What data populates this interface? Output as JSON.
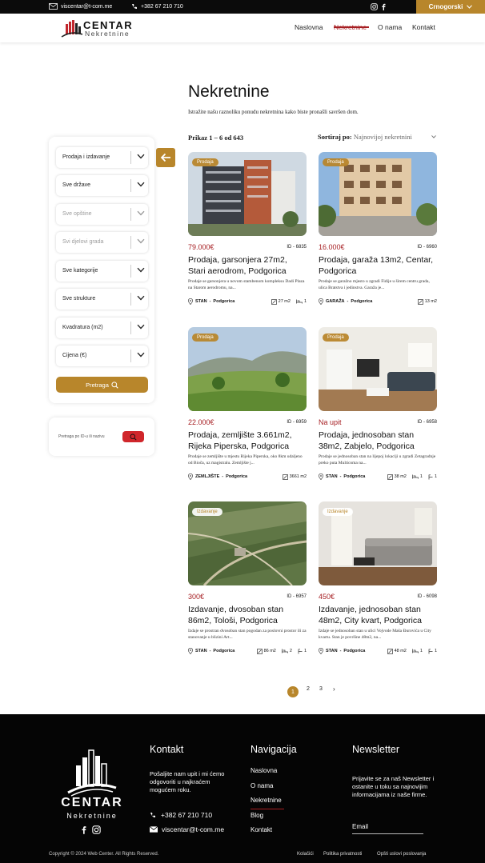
{
  "topbar": {
    "email": "viscentar@t-com.me",
    "phone": "+382 67 210 710",
    "language": "Crnogorski"
  },
  "header": {
    "logo_main": "CENTAR",
    "logo_sub": "Nekretnine",
    "nav": [
      "Naslovna",
      "Nekretnine",
      "O nama",
      "Kontakt"
    ],
    "active_nav": "Nekretnine"
  },
  "page": {
    "title": "Nekretnine",
    "intro": "Istražite našu raznoliku ponudu nekretnina kako biste pronašli savršen dom.",
    "count_text": "Prikaz 1 – 6 od 643",
    "sort_label": "Sortiraj po:",
    "sort_value": "Najnovijoj nekretnini"
  },
  "filters": {
    "selects": [
      {
        "value": "Prodaja i izdavanje",
        "disabled": false
      },
      {
        "value": "Sve države",
        "disabled": false
      },
      {
        "value": "Sve opštine",
        "disabled": true
      },
      {
        "value": "Svi djelovi grada",
        "disabled": true
      },
      {
        "value": "Sve kategorije",
        "disabled": false
      },
      {
        "value": "Sve strukture",
        "disabled": false
      },
      {
        "value": "Kvadratura (m2)",
        "disabled": false
      },
      {
        "value": "Cijena (€)",
        "disabled": false
      }
    ],
    "search_button": "Pretraga",
    "id_search_placeholder": "Pretraga po ID-u ili nazivu"
  },
  "listings": [
    {
      "badge": "Prodaja",
      "price": "79.000€",
      "id": "ID - 6835",
      "title": "Prodaja, garsonjera 27m2, Stari aerodrom, Podgorica",
      "desc": "Prodaje se garsonjera u novom stambenom kompleksu Dadi Plaza na Starom aerodromu, na...",
      "type": "STAN",
      "city": "Podgorica",
      "area": "27 m2",
      "rooms": "1",
      "baths": "",
      "image": "apartment-building-construction"
    },
    {
      "badge": "Prodaja",
      "price": "16.000€",
      "id": "ID - 6960",
      "title": "Prodaja, garaža 13m2, Centar, Podgorica",
      "desc": "Prodaje se garažno mjesto u zgradi Fidije u širem centru grada, ulica Bratstva i jedinstva. Garaža je...",
      "type": "GARAŽA",
      "city": "Podgorica",
      "area": "13 m2",
      "rooms": "",
      "baths": "",
      "image": "residential-building"
    },
    {
      "badge": "Prodaja",
      "price": "22.000€",
      "id": "ID - 6959",
      "title": "Prodaja, zemljište 3.661m2, Rijeka Piperska, Podgorica",
      "desc": "Prodaje se zemljište u mjestu Rijeka Piperska, oko 8km udaljeno od Bioča, uz magistralu. Zemljište j...",
      "type": "ZEMLJIŠTE",
      "city": "Podgorica",
      "area": "3661 m2",
      "rooms": "",
      "baths": "",
      "image": "land-with-hills"
    },
    {
      "badge": "Prodaja",
      "price": "Na upit",
      "id": "ID - 6958",
      "title": "Prodaja, jednosoban stan 38m2, Zabjelo, Podgorica",
      "desc": "Prodaje se jednosoban stan na lijepoj lokaciji u zgradi Zetagradnje preko puta Multicoma na...",
      "type": "STAN",
      "city": "Podgorica",
      "area": "38 m2",
      "rooms": "1",
      "baths": "1",
      "image": "living-room-interior"
    },
    {
      "badge": "Izdavanje",
      "price": "300€",
      "id": "ID - 6957",
      "title": "Izdavanje, dvosoban stan 86m2, Tološi, Podgorica",
      "desc": "Izdaje se prostran dvosoban stan pogodan za poslovni prostor ili za stanovanje u blizini Art...",
      "type": "STAN",
      "city": "Podgorica",
      "area": "86 m2",
      "rooms": "2",
      "baths": "1",
      "image": "aerial-map"
    },
    {
      "badge": "Izdavanje",
      "price": "450€",
      "id": "ID - 6098",
      "title": "Izdavanje, jednosoban stan 48m2, City kvart, Podgorica",
      "desc": "Izdaje se jednosoban stan u ulici Vojvode Maša Đurovića u City kvartu. Stan je površine 48m2, na...",
      "type": "STAN",
      "city": "Podgorica",
      "area": "48 m2",
      "rooms": "1",
      "baths": "1",
      "image": "living-room-sofa"
    }
  ],
  "pagination": {
    "pages": [
      "1",
      "2",
      "3"
    ],
    "current": "1",
    "next": "›"
  },
  "footer": {
    "logo_main": "CENTAR",
    "logo_sub": "Nekretnine",
    "contact_title": "Kontakt",
    "contact_text": "Pošaljite nam upit i mi ćemo odgovoriti u najkraćem mogućem roku.",
    "phone": "+382 67 210 710",
    "email": "viscentar@t-com.me",
    "nav_title": "Navigacija",
    "nav": [
      "Naslovna",
      "O nama",
      "Nekretnine",
      "Blog",
      "Kontakt"
    ],
    "newsletter_title": "Newsletter",
    "newsletter_text": "Prijavite se za naš Newsletter i ostanite u toku sa najnovijim informacijama iz naše firme.",
    "email_placeholder": "Email",
    "copyright": "Copyright © 2024 Web Center. All Rights Reserved.",
    "links": [
      "Kolačići",
      "Politika privatnosti",
      "Opšti uslovi poslovanja"
    ]
  },
  "colors": {
    "accent": "#b8862b",
    "brand_red": "#a61e22",
    "footer_bg": "#050505"
  }
}
